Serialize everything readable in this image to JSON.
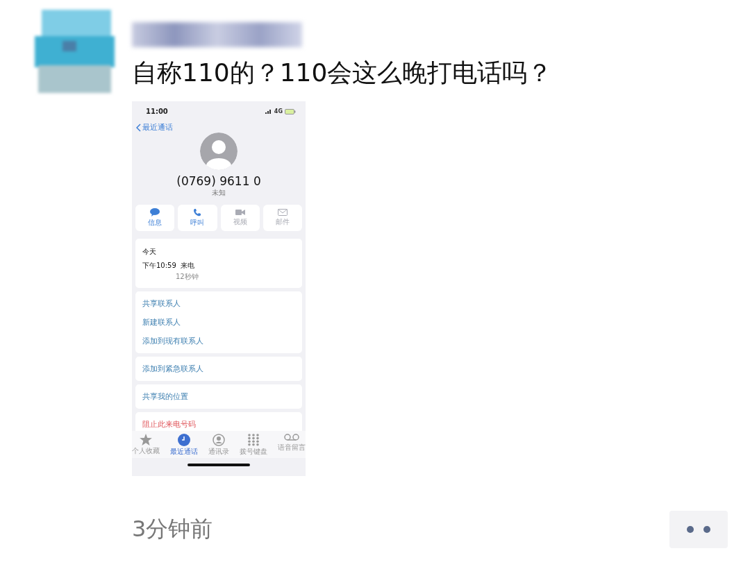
{
  "post": {
    "text": "自称110的？110会这么晚打电话吗？",
    "time": "3分钟前"
  },
  "phone": {
    "status_time": "11:00",
    "network": "4G",
    "back": "最近通话",
    "number": "(0769) 9611 0",
    "label": "未知",
    "actions": [
      {
        "kind": "message",
        "label": "信息",
        "disabled": false
      },
      {
        "kind": "call",
        "label": "呼叫",
        "disabled": false
      },
      {
        "kind": "video",
        "label": "视频",
        "disabled": true
      },
      {
        "kind": "mail",
        "label": "邮件",
        "disabled": true
      }
    ],
    "history": {
      "day": "今天",
      "time": "下午10:59",
      "type": "来电",
      "duration": "12秒钟"
    },
    "groups": [
      [
        {
          "label": "共享联系人",
          "kind": "link"
        },
        {
          "label": "新建联系人",
          "kind": "link"
        },
        {
          "label": "添加到现有联系人",
          "kind": "link"
        }
      ],
      [
        {
          "label": "添加到紧急联系人",
          "kind": "link"
        }
      ],
      [
        {
          "label": "共享我的位置",
          "kind": "link"
        }
      ],
      [
        {
          "label": "阻止此来电号码",
          "kind": "danger"
        }
      ]
    ],
    "tabs": [
      {
        "kind": "star",
        "label": "个人收藏",
        "selected": false
      },
      {
        "kind": "clock",
        "label": "最近通话",
        "selected": true
      },
      {
        "kind": "person",
        "label": "通讯录",
        "selected": false
      },
      {
        "kind": "keypad",
        "label": "拨号键盘",
        "selected": false
      },
      {
        "kind": "voicemail",
        "label": "语音留言",
        "selected": false
      }
    ]
  }
}
